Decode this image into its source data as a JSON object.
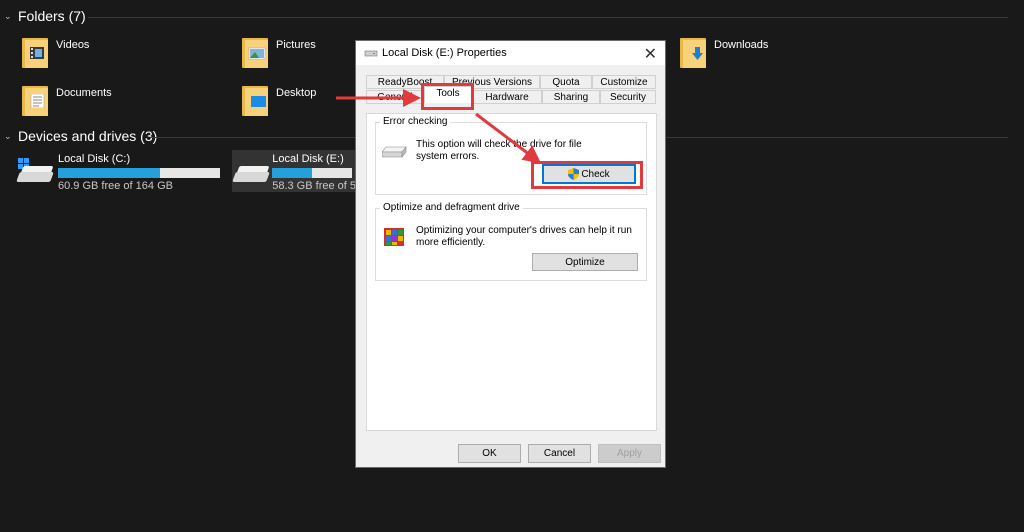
{
  "explorer": {
    "folders_header": "Folders (7)",
    "drives_header": "Devices and drives (3)",
    "folders": [
      {
        "name": "Videos",
        "icon": "videos-folder-icon"
      },
      {
        "name": "Pictures",
        "icon": "pictures-folder-icon"
      },
      {
        "name": "Downloads",
        "icon": "downloads-folder-icon"
      },
      {
        "name": "Documents",
        "icon": "documents-folder-icon"
      },
      {
        "name": "Desktop",
        "icon": "desktop-folder-icon"
      }
    ],
    "drives": [
      {
        "name": "Local Disk (C:)",
        "free": "60.9 GB free of 164 GB",
        "used_fraction": 0.63
      },
      {
        "name": "Local Disk (E:)",
        "free": "58.3 GB free of 5",
        "used_fraction": 0.5
      }
    ]
  },
  "dialog": {
    "title": "Local Disk (E:) Properties",
    "close_glyph": "✕",
    "tabs_row1": [
      "ReadyBoost",
      "Previous Versions",
      "Quota",
      "Customize"
    ],
    "tabs_row2": [
      "General",
      "Tools",
      "Hardware",
      "Sharing",
      "Security"
    ],
    "active_tab": "Tools",
    "error_checking": {
      "title": "Error checking",
      "description": "This option will check the drive for file system errors.",
      "button": "Check"
    },
    "optimize": {
      "title": "Optimize and defragment drive",
      "description": "Optimizing your computer's drives can help it run more efficiently.",
      "button": "Optimize"
    },
    "footer": {
      "ok": "OK",
      "cancel": "Cancel",
      "apply": "Apply"
    }
  },
  "colors": {
    "highlight": "#e0393e",
    "accent": "#26a0da",
    "focus": "#0078d7"
  }
}
